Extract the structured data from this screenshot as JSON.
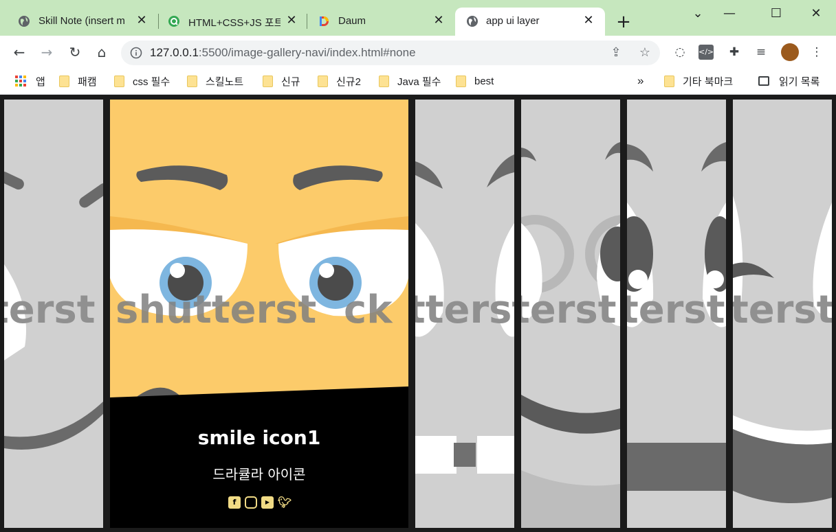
{
  "browser": {
    "tabs": [
      {
        "title": "Skill Note (insert m",
        "favicon": "globe-icon"
      },
      {
        "title": "HTML+CSS+JS 포트",
        "favicon": "q-icon"
      },
      {
        "title": "Daum",
        "favicon": "daum-icon"
      },
      {
        "title": "app ui layer",
        "favicon": "globe-icon",
        "active": true
      }
    ],
    "close_glyph": "✕",
    "new_tab": "+",
    "url_host": "127.0.0.1",
    "url_rest": ":5500/image-gallery-navi/index.html#none",
    "bookmarks": [
      {
        "label": "앱",
        "icon": "apps-icon"
      },
      {
        "label": "패캠",
        "icon": "folder-icon"
      },
      {
        "label": "css 필수",
        "icon": "folder-icon"
      },
      {
        "label": "스킬노트",
        "icon": "folder-icon"
      },
      {
        "label": "신규",
        "icon": "folder-icon"
      },
      {
        "label": "신규2",
        "icon": "folder-icon"
      },
      {
        "label": "Java 필수",
        "icon": "folder-icon"
      },
      {
        "label": "best",
        "icon": "folder-icon"
      }
    ],
    "bookmarks_overflow": "»",
    "other_bookmarks": "기타 북마크",
    "reading_list": "읽기 목록"
  },
  "gallery": {
    "active_item": {
      "title": "smile icon1",
      "subtitle": "드라큘라 아이콘",
      "social_icons": [
        "facebook-icon",
        "instagram-icon",
        "youtube-icon",
        "twitter-icon"
      ]
    },
    "watermark_text": "shutterstock",
    "accent_color": "#f1db85",
    "face_color": "#fccb6a"
  }
}
